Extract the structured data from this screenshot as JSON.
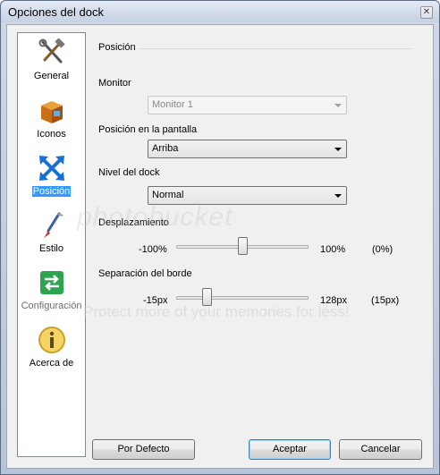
{
  "window": {
    "title": "Opciones del dock",
    "close_glyph": "✕"
  },
  "sidebar": {
    "items": [
      {
        "label": "General",
        "icon": "tools-icon"
      },
      {
        "label": "Iconos",
        "icon": "box-icon"
      },
      {
        "label": "Posición",
        "icon": "arrows-icon",
        "selected": true
      },
      {
        "label": "Estilo",
        "icon": "brush-icon"
      },
      {
        "label": "Configuración",
        "icon": "config-icon"
      },
      {
        "label": "Acerca de",
        "icon": "info-icon"
      }
    ]
  },
  "position": {
    "group_title": "Posición",
    "monitor_label": "Monitor",
    "monitor_value": "Monitor 1",
    "screen_position_label": "Posición en la pantalla",
    "screen_position_value": "Arriba",
    "dock_level_label": "Nivel del dock",
    "dock_level_value": "Normal",
    "offset_label": "Desplazamiento",
    "offset_min": "-100%",
    "offset_max": "100%",
    "offset_current": "(0%)",
    "offset_fraction": 0.5,
    "edge_label": "Separación del borde",
    "edge_min": "-15px",
    "edge_max": "128px",
    "edge_current": "(15px)",
    "edge_fraction": 0.21
  },
  "buttons": {
    "defaults": "Por Defecto",
    "accept": "Aceptar",
    "cancel": "Cancelar"
  },
  "watermark": {
    "brand": "photobucket",
    "tagline": "Protect more of your memories for less!"
  }
}
